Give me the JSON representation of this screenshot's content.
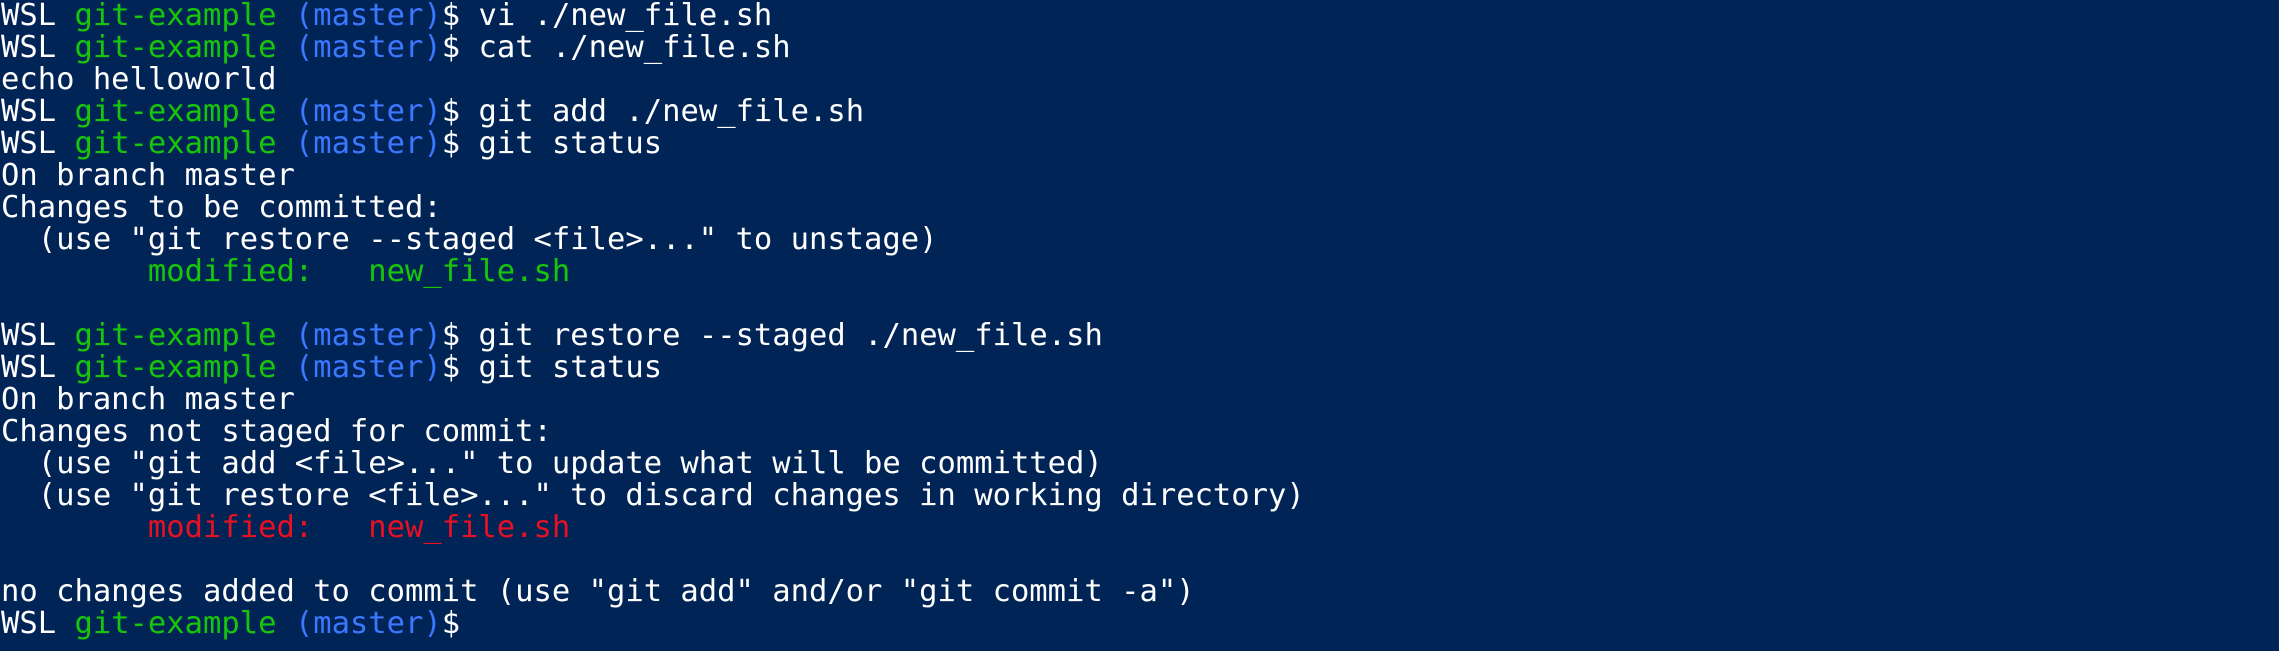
{
  "prompt": {
    "host": "WSL",
    "dir": "git-example",
    "branch": "(master)",
    "symbol": "$"
  },
  "lines": [
    {
      "type": "prompt",
      "cmd": " vi ./new_file.sh"
    },
    {
      "type": "prompt",
      "cmd": " cat ./new_file.sh"
    },
    {
      "type": "out",
      "text": "echo helloworld"
    },
    {
      "type": "prompt",
      "cmd": " git add ./new_file.sh"
    },
    {
      "type": "prompt",
      "cmd": " git status"
    },
    {
      "type": "out",
      "text": "On branch master"
    },
    {
      "type": "out",
      "text": "Changes to be committed:"
    },
    {
      "type": "out",
      "text": "  (use \"git restore --staged <file>...\" to unstage)"
    },
    {
      "type": "staged",
      "text": "        modified:   new_file.sh"
    },
    {
      "type": "blank",
      "text": ""
    },
    {
      "type": "prompt",
      "cmd": " git restore --staged ./new_file.sh"
    },
    {
      "type": "prompt",
      "cmd": " git status"
    },
    {
      "type": "out",
      "text": "On branch master"
    },
    {
      "type": "out",
      "text": "Changes not staged for commit:"
    },
    {
      "type": "out",
      "text": "  (use \"git add <file>...\" to update what will be committed)"
    },
    {
      "type": "out",
      "text": "  (use \"git restore <file>...\" to discard changes in working directory)"
    },
    {
      "type": "unstaged",
      "text": "        modified:   new_file.sh"
    },
    {
      "type": "blank",
      "text": ""
    },
    {
      "type": "out",
      "text": "no changes added to commit (use \"git add\" and/or \"git commit -a\")"
    },
    {
      "type": "prompt",
      "cmd": ""
    }
  ],
  "colors": {
    "background": "#012456",
    "text": "#ffffff",
    "dir": "#16c60c",
    "branch": "#3b78ff",
    "staged": "#16c60c",
    "unstaged": "#e81123"
  }
}
